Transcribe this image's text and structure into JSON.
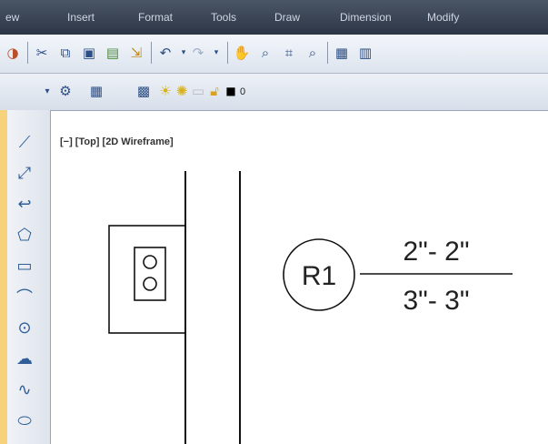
{
  "menubar": {
    "items": [
      "ew",
      "Insert",
      "Format",
      "Tools",
      "Draw",
      "Dimension",
      "Modify"
    ]
  },
  "layer_toolbar": {
    "current_layer": "0"
  },
  "viewport": {
    "label": "[−] [Top] [2D Wireframe]"
  },
  "tag": {
    "id": "R1",
    "top_text": "2\"- 2\"",
    "bottom_text": "3\"- 3\""
  },
  "colors": {
    "menubar": "#3a4456",
    "frame": "#f6d27a",
    "canvas": "#ffffff",
    "accent": "#2c4f86"
  },
  "draw_tools": [
    "line-icon",
    "construction-line-icon",
    "polyline-icon",
    "polygon-icon",
    "rectangle-icon",
    "arc-icon",
    "circle-icon",
    "revision-cloud-icon",
    "spline-icon",
    "ellipse-icon"
  ]
}
